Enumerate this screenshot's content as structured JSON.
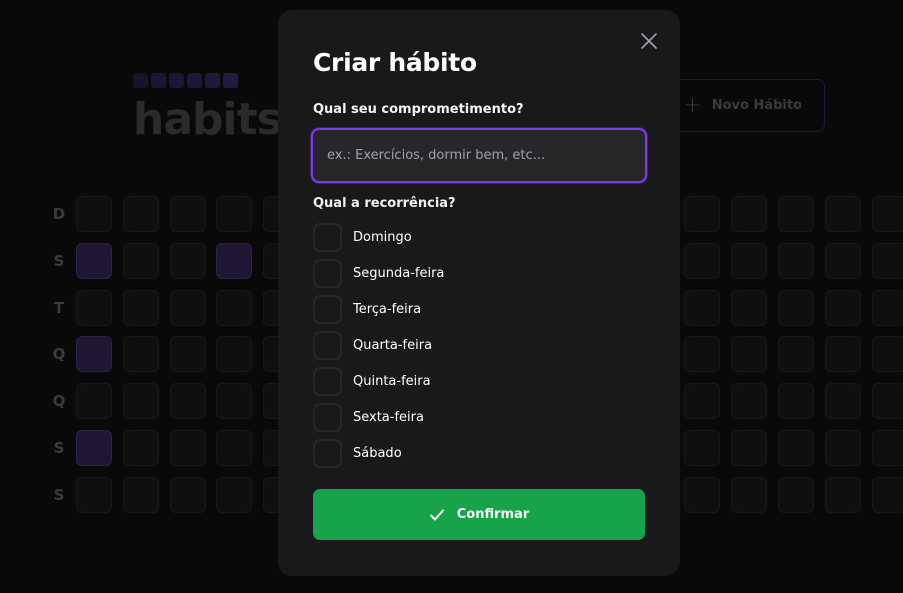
{
  "app": {
    "logo_text": "habits",
    "logo_block_colors": [
      "#16132a",
      "#1c1536",
      "#1e1638",
      "#1d1636",
      "#1f1839",
      "#231a40"
    ],
    "new_habit_label": "Novo Hábito",
    "weekdays": [
      "D",
      "S",
      "T",
      "Q",
      "Q",
      "S",
      "S"
    ],
    "completed_color": "#1e1633",
    "grid_completed": [
      [
        1,
        0
      ],
      [
        3,
        0
      ],
      [
        5,
        0
      ],
      [
        1,
        3
      ]
    ]
  },
  "modal": {
    "title": "Criar hábito",
    "commitment_label": "Qual seu comprometimento?",
    "commitment_placeholder": "ex.: Exercícios, dormir bem, etc...",
    "commitment_value": "",
    "recurrence_label": "Qual a recorrência?",
    "days": [
      {
        "label": "Domingo",
        "checked": false
      },
      {
        "label": "Segunda-feira",
        "checked": false
      },
      {
        "label": "Terça-feira",
        "checked": false
      },
      {
        "label": "Quarta-feira",
        "checked": false
      },
      {
        "label": "Quinta-feira",
        "checked": false
      },
      {
        "label": "Sexta-feira",
        "checked": false
      },
      {
        "label": "Sábado",
        "checked": false
      }
    ],
    "confirm_label": "Confirmar",
    "accent_color": "#7c3aed",
    "confirm_color": "#16a34a"
  }
}
